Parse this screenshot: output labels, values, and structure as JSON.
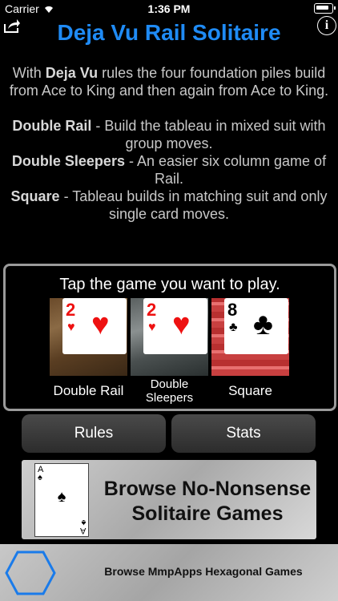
{
  "status_bar": {
    "carrier": "Carrier",
    "time": "1:36 PM"
  },
  "header": {
    "title": "Deja Vu Rail Solitaire"
  },
  "description": {
    "intro_prefix": "With ",
    "intro_bold": "Deja Vu",
    "intro_rest": " rules the four foundation piles build from Ace to King and then again from Ace to King.",
    "rules": [
      {
        "name": "Double Rail",
        "text": " - Build the tableau in mixed suit with group moves."
      },
      {
        "name": "Double Sleepers",
        "text": " - An easier six column game of Rail."
      },
      {
        "name": "Square",
        "text": " - Tableau builds in matching suit and only single card moves."
      }
    ]
  },
  "game_picker": {
    "prompt": "Tap the game you want to play.",
    "games": [
      {
        "label": "Double Rail",
        "card_rank": "2",
        "card_suit": "♥"
      },
      {
        "label": "Double Sleepers",
        "card_rank": "2",
        "card_suit": "♥"
      },
      {
        "label": "Square",
        "card_rank": "8",
        "card_suit": "♣"
      }
    ]
  },
  "buttons": {
    "rules": "Rules",
    "stats": "Stats"
  },
  "promo": {
    "browse_line1": "Browse No-Nonsense",
    "browse_line2": "Solitaire Games",
    "ace_rank": "A",
    "ace_suit": "♠",
    "hex_text": "Browse MmpApps Hexagonal Games"
  },
  "colors": {
    "title": "#1f8bf5",
    "hex_outline": "#1a7bea"
  }
}
